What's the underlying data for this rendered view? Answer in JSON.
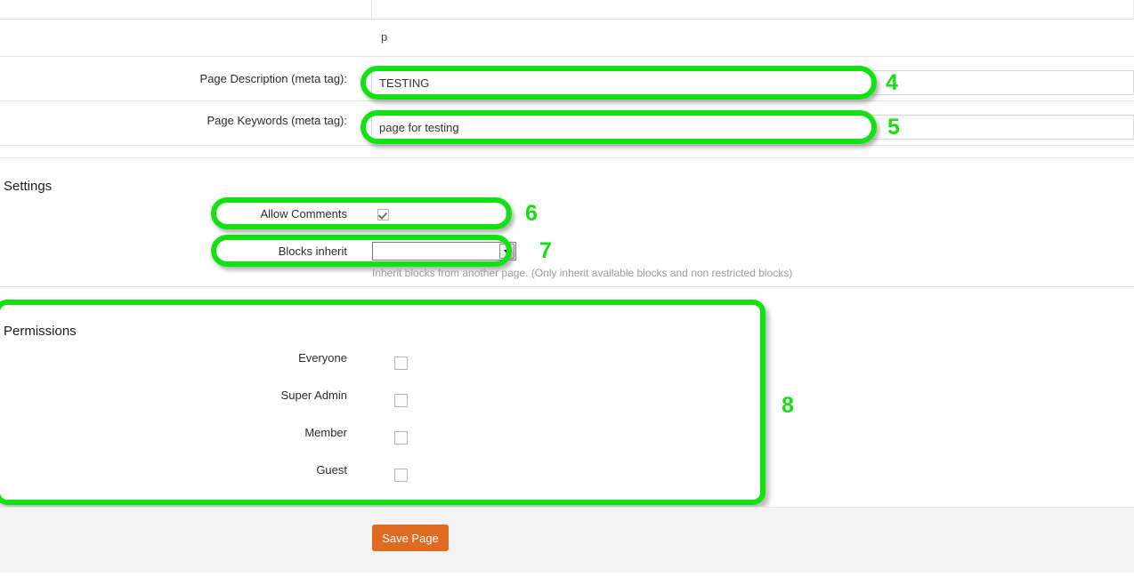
{
  "editor": {
    "element_path": "p"
  },
  "meta_fields": [
    {
      "label": "Page Description (meta tag):",
      "value": "TESTING",
      "annotation": "4"
    },
    {
      "label": "Page Keywords (meta tag):",
      "value": "page for testing",
      "annotation": "5"
    }
  ],
  "settings": {
    "title": "Settings",
    "allow_comments": {
      "label": "Allow Comments",
      "checked": true,
      "annotation": "6"
    },
    "blocks_inherit": {
      "label": "Blocks inherit",
      "selected": "",
      "annotation": "7",
      "helper": "Inherit blocks from another page. (Only inherit available blocks and non restricted blocks)"
    }
  },
  "permissions": {
    "title": "Permissions",
    "annotation": "8",
    "rows": [
      {
        "label": "Everyone",
        "checked": false
      },
      {
        "label": "Super Admin",
        "checked": false
      },
      {
        "label": "Member",
        "checked": false
      },
      {
        "label": "Guest",
        "checked": false
      }
    ]
  },
  "footer": {
    "save_label": "Save Page"
  },
  "colors": {
    "annotation_green": "#12e212",
    "save_button": "#dd6b20",
    "footer_bg": "#f4f4f4",
    "divider": "#e2e2e2"
  }
}
